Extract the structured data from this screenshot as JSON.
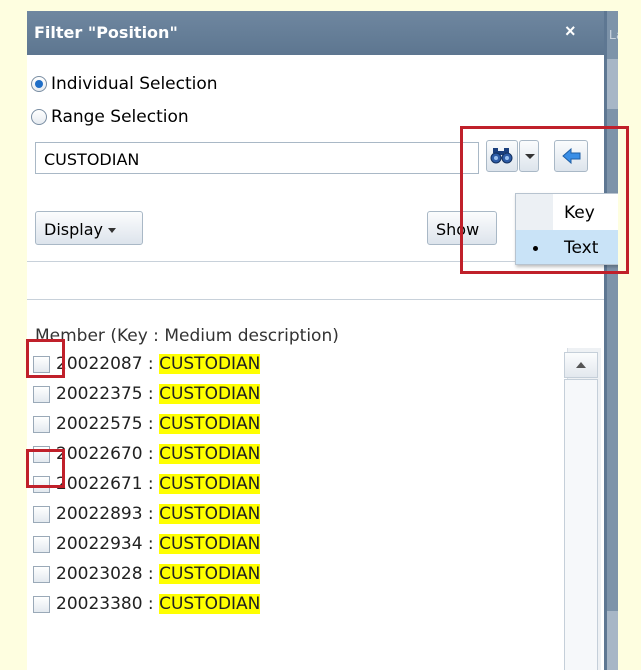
{
  "dialog": {
    "title": "Filter \"Position\"",
    "close_label": "×",
    "background_label": "La"
  },
  "selection": {
    "individual_label": "Individual Selection",
    "range_label": "Range Selection",
    "selected": "individual"
  },
  "search": {
    "value": "CUSTODIAN"
  },
  "buttons": {
    "display_label": "Display",
    "show_label": "Show"
  },
  "search_mode_menu": {
    "items": [
      {
        "label": "Key",
        "selected": false
      },
      {
        "label": "Text",
        "selected": true
      }
    ]
  },
  "list": {
    "header": "Member (Key : Medium description)",
    "separator": " : ",
    "rows": [
      {
        "key": "20022087",
        "desc": "CUSTODIAN"
      },
      {
        "key": "20022375",
        "desc": "CUSTODIAN"
      },
      {
        "key": "20022575",
        "desc": "CUSTODIAN"
      },
      {
        "key": "20022670",
        "desc": "CUSTODIAN"
      },
      {
        "key": "20022671",
        "desc": "CUSTODIAN"
      },
      {
        "key": "20022893",
        "desc": "CUSTODIAN"
      },
      {
        "key": "20022934",
        "desc": "CUSTODIAN"
      },
      {
        "key": "20023028",
        "desc": "CUSTODIAN"
      },
      {
        "key": "20023380",
        "desc": "CUSTODIAN"
      }
    ]
  },
  "colors": {
    "titlebar": "#6a829b",
    "highlight": "#ffff00",
    "annotation_red": "#c0202a",
    "menu_selected": "#c9e3f7"
  },
  "icons": {
    "find": "binoculars-icon",
    "dropdown": "chevron-down-icon",
    "back": "arrow-left-icon",
    "close": "close-icon",
    "scroll_up": "arrow-up-icon"
  }
}
